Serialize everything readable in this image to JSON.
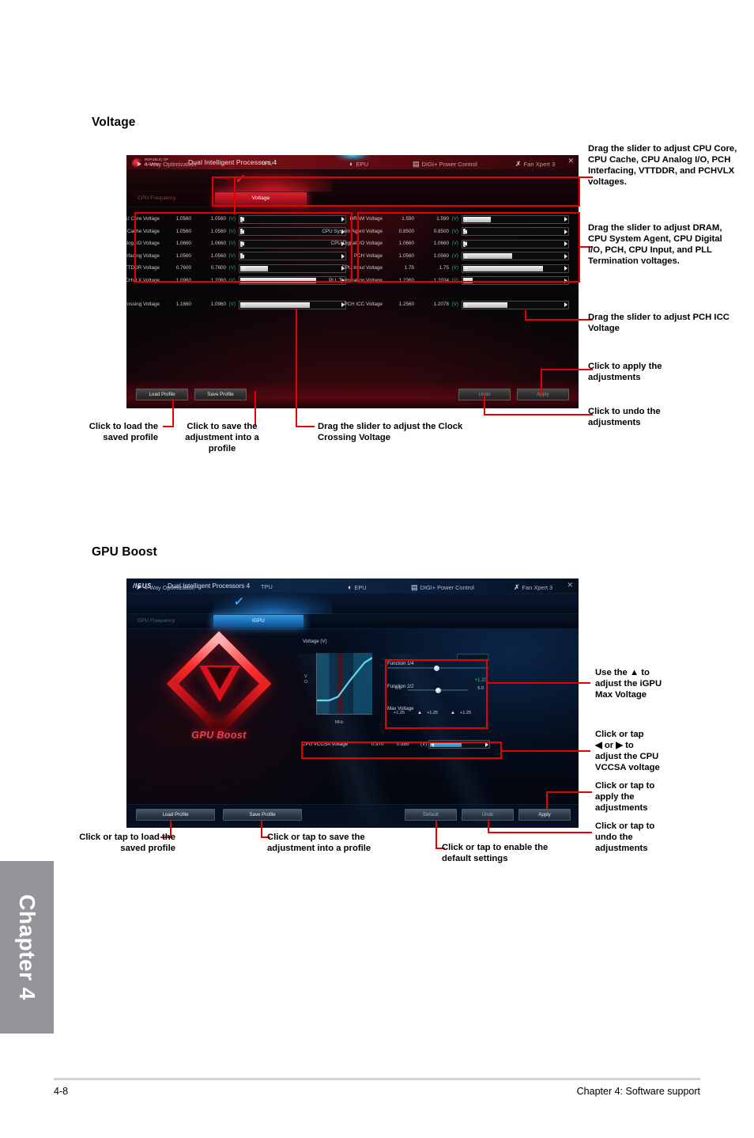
{
  "page": {
    "footer_page_number": "4-8",
    "footer_chapter": "Chapter 4: Software support",
    "side_tab": "Chapter 4",
    "accent_red": "#e60000",
    "sidebar_gray": "#939598"
  },
  "sections": {
    "voltage_title": "Voltage",
    "gpu_boost_title": "GPU Boost"
  },
  "voltage_app": {
    "brand_line1": "REPUBLIC OF",
    "brand_line2": "GAMERS",
    "window_title": "Dual Intelligent Processors 4",
    "close_glyph": "✕",
    "nav": [
      {
        "label": "4-Way Optimization",
        "icon": "optimization-icon",
        "glyph": "➤"
      },
      {
        "label": "TPU",
        "icon": "tpu-icon",
        "glyph": ""
      },
      {
        "label": "EPU",
        "icon": "epu-icon",
        "glyph": "◐"
      },
      {
        "label": "DIGI+ Power Control",
        "icon": "digi-power-icon",
        "glyph": "▤"
      },
      {
        "label": "Fan Xpert 3",
        "icon": "fan-xpert-icon",
        "glyph": "✗"
      }
    ],
    "subtabs": {
      "inactive": "CPU Frequency",
      "active": "Voltage"
    },
    "left_panel": [
      {
        "label": "CPU Core Voltage",
        "current": "1.0560",
        "target": "1.0560",
        "unit": "(V)",
        "fill": 2
      },
      {
        "label": "CPU Cache Voltage",
        "current": "1.0560",
        "target": "1.0560",
        "unit": "(V)",
        "fill": 2
      },
      {
        "label": "CPU Analog I/O Voltage",
        "current": "1.0660",
        "target": "1.0660",
        "unit": "(V)",
        "fill": 2
      },
      {
        "label": "PCH Interfacing Voltage",
        "current": "1.0560",
        "target": "1.0560",
        "unit": "(V)",
        "fill": 2
      },
      {
        "label": "VTTDDR Voltage",
        "current": "0.7600",
        "target": "0.7600",
        "unit": "(V)",
        "fill": 26
      },
      {
        "label": "PCHVLX Voltage",
        "current": "1.0960",
        "target": "1.2060",
        "unit": "(V)",
        "fill": 72
      }
    ],
    "right_panel": [
      {
        "label": "DRAM Voltage",
        "current": "1.590",
        "target": "1.590",
        "unit": "(V)",
        "fill": 26
      },
      {
        "label": "CPU System Agent Voltage",
        "current": "0.8500",
        "target": "0.8500",
        "unit": "(V)",
        "fill": 2
      },
      {
        "label": "CPU Digital I/O Voltage",
        "current": "1.0660",
        "target": "1.0660",
        "unit": "(V)",
        "fill": 2
      },
      {
        "label": "PCH Voltage",
        "current": "1.0560",
        "target": "1.0560",
        "unit": "(V)",
        "fill": 46
      },
      {
        "label": "CPU Input Voltage",
        "current": "1.75",
        "target": "1.75",
        "unit": "(V)",
        "fill": 75
      },
      {
        "label": "PLL Termination Voltage",
        "current": "1.2360",
        "target": "1.2034",
        "unit": "(V)",
        "fill": 9
      }
    ],
    "clock_crossing": {
      "label": "Clock Crossing Voltage",
      "current": "1.1660",
      "target": "1.0960",
      "unit": "(V)",
      "fill": 66
    },
    "pch_icc": {
      "label": "PCH ICC Voltage",
      "current": "1.2560",
      "target": "1.2078",
      "unit": "(V)",
      "fill": 42
    },
    "buttons": {
      "load_profile": "Load Profile",
      "save_profile": "Save Profile",
      "undo": "Undo",
      "apply": "Apply"
    }
  },
  "voltage_annotations": {
    "top_right": "Drag the slider to adjust CPU Core, CPU Cache, CPU Analog I/O, PCH Interfacing, VTTDDR, and PCHVLX voltages.",
    "mid_right": "Drag the slider to adjust DRAM, CPU System Agent, CPU Digital I/O, PCH, CPU Input, and PLL Termination voltages.",
    "pch_icc": "Drag the slider to adjust PCH ICC Voltage",
    "apply": "Click to apply the adjustments",
    "undo": "Click to undo the adjustments",
    "load": "Click to load the saved profile",
    "save": "Click to save the adjustment into a profile",
    "clock_crossing": "Drag the slider to adjust the Clock Crossing Voltage"
  },
  "gpu_app": {
    "brand": "/ISUS",
    "window_title": "Dual Intelligent Processors 4",
    "close_glyph": "✕",
    "nav": [
      {
        "label": "4-Way Optimization",
        "icon": "optimization-icon",
        "glyph": "➤"
      },
      {
        "label": "TPU",
        "icon": "tpu-icon",
        "glyph": ""
      },
      {
        "label": "EPU",
        "icon": "epu-icon",
        "glyph": "◐"
      },
      {
        "label": "DIGI+ Power Control",
        "icon": "digi-power-icon",
        "glyph": "▤"
      },
      {
        "label": "Fan Xpert 3",
        "icon": "fan-xpert-icon",
        "glyph": "✗"
      }
    ],
    "subtabs": {
      "inactive": "GPU Frequency",
      "active": "iGPU"
    },
    "logo_text": "GPU Boost",
    "chart": {
      "caption": "Voltage (V)",
      "ylabel": "V",
      "xlabel": "MHz"
    },
    "controls": {
      "func1_label": "Function 1/4",
      "func1_value": "",
      "func2_label": "Function 2/2",
      "func2_value": "+1.20",
      "func2_min": "0.0",
      "func2_max": "5.0",
      "max_voltage_label": "Max Voltage",
      "step1": "+1.25",
      "step2": "+1.25",
      "step3": "+1.25"
    },
    "vccsa": {
      "label": "CPU VCCSA Voltage",
      "current": "0.970",
      "target": "0.885",
      "unit": "(V)",
      "fill": 52
    },
    "buttons": {
      "load_profile": "Load Profile",
      "save_profile": "Save Profile",
      "default": "Default",
      "undo": "Undo",
      "apply": "Apply"
    }
  },
  "gpu_annotations": {
    "max_voltage": "Use the ▲ to adjust the iGPU Max Voltage",
    "vccsa_line1": "Click or tap",
    "vccsa_line2_pre": "◀",
    "vccsa_line2_mid": " or ",
    "vccsa_line2_post": "▶",
    "vccsa_line2_end": " to",
    "vccsa_line3": "adjust the CPU",
    "vccsa_line4": "VCCSA voltage",
    "apply": "Click or tap to apply the adjustments",
    "undo": "Click or tap to undo the adjustments",
    "load": "Click or tap to load the saved profile",
    "save": "Click or tap to save the adjustment into a profile",
    "default": "Click or tap to enable the default settings"
  }
}
